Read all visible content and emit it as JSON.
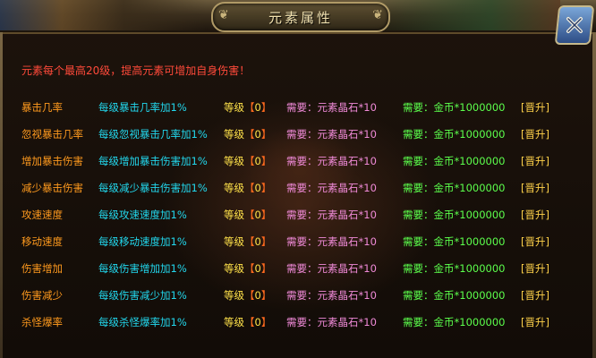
{
  "window": {
    "title": "元素属性",
    "intro": "元素每个最高20级，提高元素可增加自身伤害！"
  },
  "attributes": [
    {
      "name": "暴击几率",
      "desc": "每级暴击几率加1%",
      "level_label": "等级",
      "level_value": "0",
      "req_crystal": "需要：元素晶石*10",
      "req_gold": "需要：金币*1000000",
      "button": "[晋升]"
    },
    {
      "name": "忽视暴击几率",
      "desc": "每级忽视暴击几率加1%",
      "level_label": "等级",
      "level_value": "0",
      "req_crystal": "需要：元素晶石*10",
      "req_gold": "需要：金币*1000000",
      "button": "[晋升]"
    },
    {
      "name": "增加暴击伤害",
      "desc": "每级增加暴击伤害加1%",
      "level_label": "等级",
      "level_value": "0",
      "req_crystal": "需要：元素晶石*10",
      "req_gold": "需要：金币*1000000",
      "button": "[晋升]"
    },
    {
      "name": "减少暴击伤害",
      "desc": "每级减少暴击伤害加1%",
      "level_label": "等级",
      "level_value": "0",
      "req_crystal": "需要：元素晶石*10",
      "req_gold": "需要：金币*1000000",
      "button": "[晋升]"
    },
    {
      "name": "攻速速度",
      "desc": "每级攻速速度加1%",
      "level_label": "等级",
      "level_value": "0",
      "req_crystal": "需要：元素晶石*10",
      "req_gold": "需要：金币*1000000",
      "button": "[晋升]"
    },
    {
      "name": "移动速度",
      "desc": "每级移动速度加1%",
      "level_label": "等级",
      "level_value": "0",
      "req_crystal": "需要：元素晶石*10",
      "req_gold": "需要：金币*1000000",
      "button": "[晋升]"
    },
    {
      "name": "伤害增加",
      "desc": "每级伤害增加加1%",
      "level_label": "等级",
      "level_value": "0",
      "req_crystal": "需要：元素晶石*10",
      "req_gold": "需要：金币*1000000",
      "button": "[晋升]"
    },
    {
      "name": "伤害减少",
      "desc": "每级伤害减少加1%",
      "level_label": "等级",
      "level_value": "0",
      "req_crystal": "需要：元素晶石*10",
      "req_gold": "需要：金币*1000000",
      "button": "[晋升]"
    },
    {
      "name": "杀怪爆率",
      "desc": "每级杀怪爆率加1%",
      "level_label": "等级",
      "level_value": "0",
      "req_crystal": "需要：元素晶石*10",
      "req_gold": "需要：金币*1000000",
      "button": "[晋升]"
    }
  ],
  "icons": {
    "close": "close-x-icon",
    "title_ornament": "scroll-ornament-icon"
  },
  "colors": {
    "intro": "#ff4a3a",
    "name": "#ff9a1e",
    "desc": "#22d8ee",
    "level": "#ffe24a",
    "crystal": "#f08ad8",
    "gold": "#5cff4c",
    "button": "#ffd24a"
  }
}
